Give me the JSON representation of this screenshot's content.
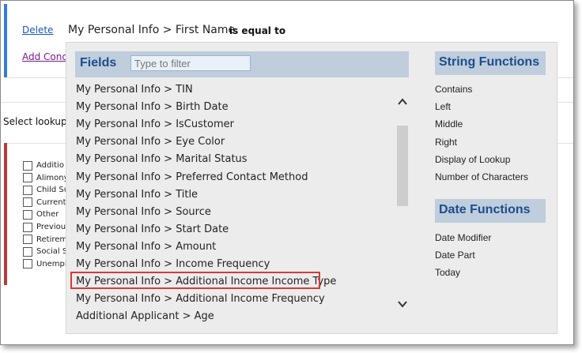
{
  "condition": {
    "delete_label": "Delete",
    "add_condition_label": "Add Condi",
    "field_path": "My Personal Info > First Name",
    "operator": "is equal to"
  },
  "lookup": {
    "label": "Select lookup",
    "options": [
      "Additio",
      "Alimony",
      "Child Su",
      "Current",
      "Other",
      "Previous",
      "Retirem",
      "Social S",
      "Unempl"
    ]
  },
  "fields_panel": {
    "title": "Fields",
    "filter_placeholder": "Type to filter",
    "items": [
      "My Personal Info > TIN",
      "My Personal Info > Birth Date",
      "My Personal Info > IsCustomer",
      "My Personal Info > Eye Color",
      "My Personal Info > Marital Status",
      "My Personal Info > Preferred Contact Method",
      "My Personal Info > Title",
      "My Personal Info > Source",
      "My Personal Info > Start Date",
      "My Personal Info > Amount",
      "My Personal Info > Income Frequency",
      "My Personal Info > Additional Income Income Type",
      "My Personal Info > Additional Income Frequency",
      "Additional Applicant > Age"
    ],
    "highlighted_item": "My Personal Info > Additional Income Income Type"
  },
  "string_functions": {
    "title": "String Functions",
    "items": [
      "Contains",
      "Left",
      "Middle",
      "Right",
      "Display of Lookup",
      "Number of Characters"
    ]
  },
  "date_functions": {
    "title": "Date Functions",
    "items": [
      "Date Modifier",
      "Date Part",
      "Today"
    ]
  },
  "colors": {
    "header_bg": "#bfcddd",
    "header_text": "#1c4d8c",
    "highlight_border": "#d63b3b",
    "link_blue": "#1a56c2",
    "accent_bar_blue": "#2f7fd4",
    "accent_bar_red": "#b83a3a"
  },
  "icons": {
    "scroll_up": "chevron-up-icon",
    "scroll_down": "chevron-down-icon"
  }
}
